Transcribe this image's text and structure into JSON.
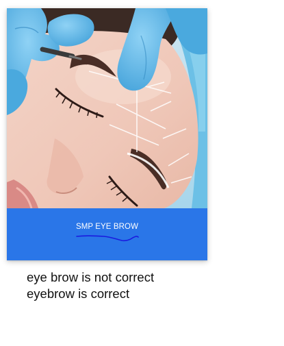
{
  "card": {
    "caption": "SMP EYE BROW",
    "caption_bar_color": "#2a76e8",
    "annotation_color": "#1a1adf"
  },
  "note": {
    "text": "eye brow is not correct eyebrow is correct"
  },
  "photo": {
    "subject": "close-up of woman's face during eyebrow microblading, gloved hands with tool, white guide lines drawn on skin",
    "glove_color": "#5ab4e8",
    "cap_color": "#7fc9e8"
  }
}
